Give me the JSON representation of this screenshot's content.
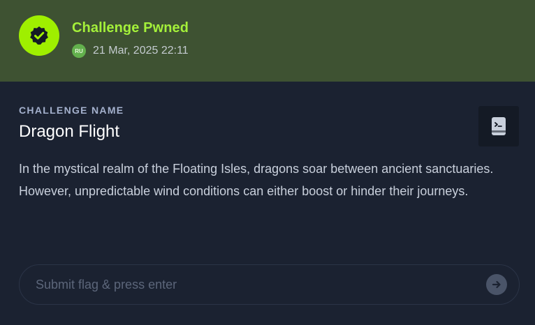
{
  "banner": {
    "title": "Challenge Pwned",
    "avatar_initials": "RU",
    "timestamp": "21 Mar, 2025 22:11",
    "badge_icon": "verified-check-icon",
    "colors": {
      "banner_bg": "#3e5232",
      "accent": "#9fef00"
    }
  },
  "challenge": {
    "section_label": "CHALLENGE NAME",
    "name": "Dragon Flight",
    "description": "In the mystical realm of the Floating Isles, dragons soar between ancient sanctuaries. However, unpredictable wind conditions can either boost or hinder their journeys.",
    "action_icon": "terminal-book-icon"
  },
  "flag": {
    "placeholder": "Submit flag & press enter",
    "value": "",
    "submit_icon": "arrow-right-icon"
  }
}
